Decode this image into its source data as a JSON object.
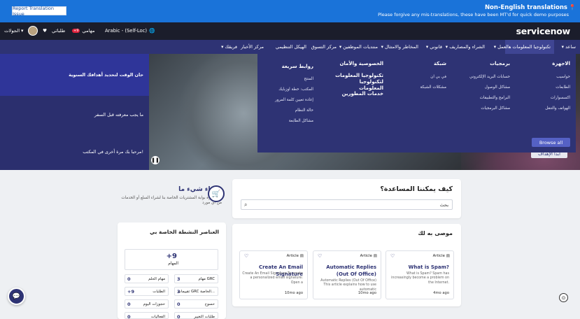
{
  "banner": {
    "report_button": "Report Translation Issue",
    "title": "Non-English translations",
    "subtitle": "Please forgive any mis-translations, these have been MT'd for quick demo purposes"
  },
  "header": {
    "logo": "servicenow",
    "language": "Arabic - (Self-Loc)",
    "tasks_label": "مهامي",
    "tasks_badge": "+9",
    "requests_label": "طلباتي",
    "tours_label": "الجولات"
  },
  "nav": {
    "items": [
      "ساعد",
      "تكنولوجيا المعلومات",
      "العمل",
      "الشراء والمصاريف",
      "قانوني",
      "المخاطر والامتثال",
      "منتديات الموظفين",
      "مركز التسوق",
      "الهيكل التنظيمي",
      "مركز الأخبار",
      "فريقك"
    ]
  },
  "mega_menu": {
    "columns": [
      {
        "heading": "الاجهزة",
        "links": [
          "حواسيب",
          "الطابعات",
          "اكسسوارات",
          "الهواتف والتنقل"
        ]
      },
      {
        "heading": "برمجيات",
        "links": [
          "حسابات البريد الإلكتروني",
          "مشاكل الوصول",
          "البرامج والتطبيقات",
          "مشاكل البرمجيات"
        ]
      },
      {
        "heading": "شبكة",
        "links": [
          "في بي ان",
          "مشكلات الشبكة"
        ]
      },
      {
        "heading": "الخصوصية والأمان",
        "links": []
      },
      {
        "heading": "تكنولوجيا المعلومات لتكنولوجيا المعلومات",
        "links": []
      },
      {
        "heading": "خدمات المطورين",
        "links": []
      },
      {
        "heading": "روابط سريعة",
        "links": [
          "المنتج",
          "المكتب: خطة اوزبايك",
          "إعادة تعيين كلمة المرور",
          "حالة النظام",
          "مشاكل الطابعة"
        ]
      }
    ],
    "browse_all": "Browse all"
  },
  "hero": {
    "slides": [
      "حان الوقت لتحديد أهدافك السنوية",
      "ما يجب معرفته قبل السفر",
      "مرحبا بك مرة أخرى في المكتب!"
    ],
    "cta": "ابدأ الإهداف"
  },
  "help": {
    "title": "كيف يمكننا المساعدة؟",
    "search_placeholder": "بحث"
  },
  "recommended": {
    "title": "موصى به لك",
    "articles": [
      {
        "type": "Article",
        "title": "What is Spam?",
        "desc": "What is Spam? Spam has increasingly become a problem on the Internet.",
        "date": "4mo ago"
      },
      {
        "type": "Article",
        "title": "Automatic Replies (Out Of Office)",
        "desc": "Automatic Replies (Out Of Office) This article explains how to use automatic",
        "date": "10mo ago"
      },
      {
        "type": "Article",
        "title": "Create An Email Signature",
        "desc": "Create An Email Signature To create a personalized email signature: Open a",
        "date": "10mo ago"
      }
    ]
  },
  "buy": {
    "title": "شراء شيء ما",
    "desc": "قم بزيارة بوابة المشتريات الخاصة بنا لشراء السلع أو الخدمات من أي مورد"
  },
  "activity": {
    "title": "العناصر النشطة الخاصة بي",
    "big_num": "+9",
    "big_label": "المهام",
    "cells": [
      {
        "n": "3",
        "l": "مهام GRC"
      },
      {
        "n": "0",
        "l": "مهام الحلم"
      },
      {
        "n": "3",
        "l": "تقييمات GRC الخاصة..."
      },
      {
        "n": "+9",
        "l": "الطلبات"
      },
      {
        "n": "0",
        "l": "حسوح"
      },
      {
        "n": "0",
        "l": "حجوزات اليوم"
      },
      {
        "n": "0",
        "l": "طلبات التغيير"
      },
      {
        "n": "0",
        "l": "الفعاليات"
      }
    ]
  }
}
